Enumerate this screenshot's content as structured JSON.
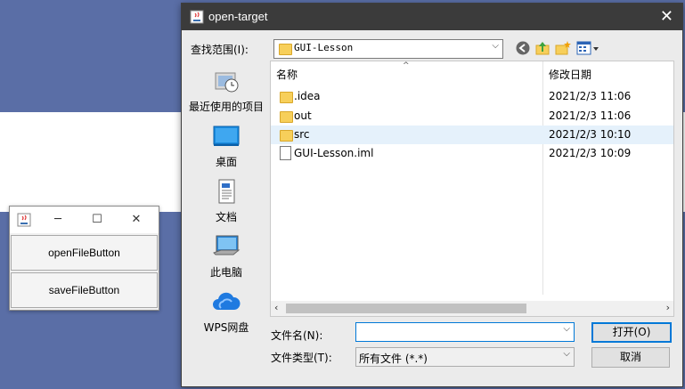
{
  "small_window": {
    "minimize_glyph": "─",
    "maximize_glyph": "☐",
    "close_glyph": "✕",
    "buttons": [
      "openFileButton",
      "saveFileButton"
    ]
  },
  "dialog": {
    "title": "open-target",
    "close_glyph": "✕",
    "look_in_label": "查找范围(I):",
    "look_in_value": "GUI-Lesson",
    "dropdown_glyph": "⌵",
    "sidebar": [
      {
        "label": "最近使用的项目",
        "icon": "recent-items-icon"
      },
      {
        "label": "桌面",
        "icon": "desktop-icon"
      },
      {
        "label": "文档",
        "icon": "documents-icon"
      },
      {
        "label": "此电脑",
        "icon": "this-pc-icon"
      },
      {
        "label": "WPS网盘",
        "icon": "cloud-drive-icon"
      }
    ],
    "columns": {
      "name": "名称",
      "date": "修改日期",
      "sort_glyph": "^"
    },
    "files": [
      {
        "name": ".idea",
        "date": "2021/2/3 11:06",
        "type": "folder"
      },
      {
        "name": "out",
        "date": "2021/2/3 11:06",
        "type": "folder"
      },
      {
        "name": "src",
        "date": "2021/2/3 10:10",
        "type": "folder",
        "selected": true
      },
      {
        "name": "GUI-Lesson.iml",
        "date": "2021/2/3 10:09",
        "type": "file"
      }
    ],
    "scroll_left_glyph": "‹",
    "scroll_right_glyph": "›",
    "filename_label": "文件名(N):",
    "filename_value": "",
    "filetype_label": "文件类型(T):",
    "filetype_value": "所有文件 (*.*)",
    "open_button": "打开(O)",
    "cancel_button": "取消"
  },
  "colors": {
    "desktop_bg": "#5a6ea6",
    "dialog_title_bg": "#3b3b3b",
    "selection": "#e5f1fb",
    "focus": "#0078d7"
  }
}
